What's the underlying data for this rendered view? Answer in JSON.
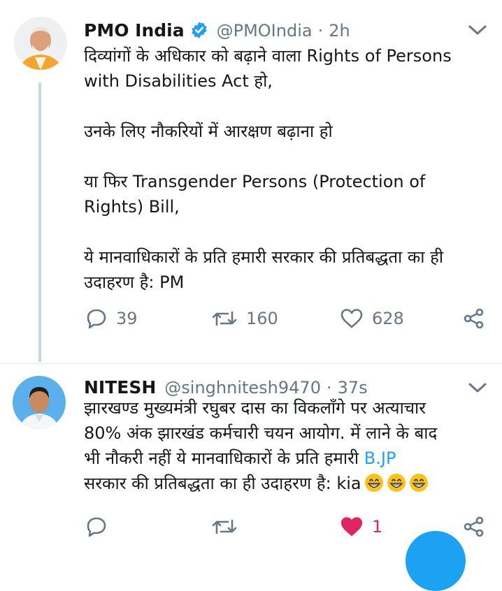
{
  "tweet1": {
    "author": "PMO India",
    "handle": "@PMOIndia",
    "sep": "·",
    "time": "2h",
    "lines": [
      "दिव्यांगों के अधिकार को बढ़ाने वाला Rights of Persons",
      "with Disabilities Act हो,",
      "",
      "उनके लिए नौकरियों में आरक्षण बढ़ाना हो",
      "",
      "या फिर Transgender Persons (Protection of",
      "Rights) Bill,",
      "",
      "ये मानवाधिकारों के प्रति हमारी सरकार की प्रतिबद्धता का ही",
      "उदाहरण है: PM"
    ],
    "replies": "39",
    "retweets": "160",
    "likes": "628"
  },
  "tweet2": {
    "author": "NITESH",
    "handle": "@singhnitesh9470",
    "sep": "·",
    "time": "37s",
    "line1": "झारखण्ड मुख्यमंत्री रघुबर दास का विकलाँगे पर अत्याचार",
    "line2": "80%   अंक झारखंड कर्मचारी चयन आयोग. में लाने के बाद",
    "line3_pre": "भी नौकरी नहीं  ये मानवाधिकारों के प्रति हमारी ",
    "line3_link": "B.JP",
    "line4": "सरकार की प्रतिबद्धता का ही उदाहरण है: kia",
    "likes": "1"
  },
  "colors": {
    "accent": "#1da1f2",
    "muted": "#657786",
    "like": "#e0245e",
    "emoji": "#fcc21b"
  },
  "icons": [
    "verified-badge-icon",
    "chevron-down-icon",
    "reply-icon",
    "retweet-icon",
    "like-icon",
    "share-icon",
    "grinning-face-emoji"
  ]
}
